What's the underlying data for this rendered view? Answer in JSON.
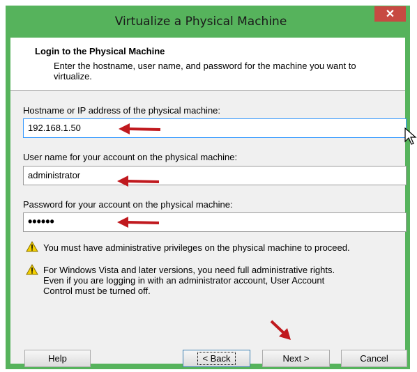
{
  "window": {
    "title": "Virtualize a Physical Machine",
    "close_label": "✕"
  },
  "header": {
    "title": "Login to the Physical Machine",
    "description": "Enter the hostname, user name, and password for the machine you want to virtualize."
  },
  "form": {
    "hostname_label": "Hostname or IP address of the physical machine:",
    "hostname_value": "192.168.1.50",
    "username_label": "User name for your account on the physical machine:",
    "username_value": "administrator",
    "password_label": "Password for your account on the physical machine:",
    "password_value": "••••••"
  },
  "warnings": [
    {
      "icon": "warning-icon",
      "text": "You must have administrative privileges on the physical machine to proceed."
    },
    {
      "icon": "warning-icon",
      "text": "For Windows Vista and later versions, you need full administrative rights. Even if you are logging in with an administrator account, User Account Control must be turned off."
    }
  ],
  "buttons": {
    "help": "Help",
    "back": "< Back",
    "next": "Next >",
    "cancel": "Cancel"
  },
  "colors": {
    "titlebar": "#56b35c",
    "close": "#c74a42",
    "arrow": "#c0191e"
  }
}
